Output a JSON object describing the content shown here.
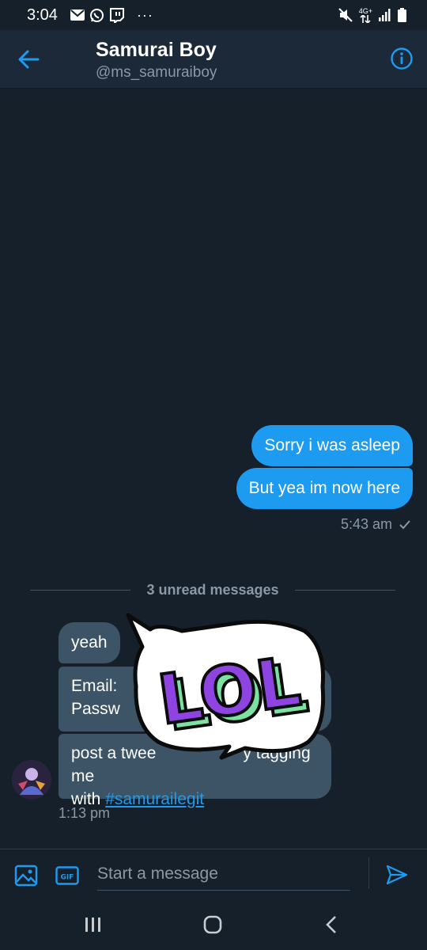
{
  "status_bar": {
    "time": "3:04",
    "more": "···",
    "network": "4G+",
    "icons_left": [
      "mail-icon",
      "whatsapp-icon",
      "twitch-icon"
    ],
    "icons_right": [
      "mute-icon",
      "data-icon",
      "signal-icon",
      "battery-icon"
    ]
  },
  "header": {
    "title": "Samurai Boy",
    "handle": "@ms_samuraiboy"
  },
  "messages_out": [
    {
      "text": "Sorry i was asleep"
    },
    {
      "text": "But yea im now here"
    }
  ],
  "out_time": "5:43 am",
  "unread_divider": "3 unread messages",
  "messages_in": [
    {
      "text": "yeah"
    },
    {
      "line1": "Email:",
      "line2": "Passw"
    },
    {
      "line1": "post a twee",
      "line1_rest": "y tagging me",
      "line2_prefix": "with ",
      "hashtag": "#samurailegit"
    }
  ],
  "in_time": "1:13 pm",
  "sticker": {
    "text": "LOL"
  },
  "composer": {
    "placeholder": "Start a message",
    "gif_label": "GIF"
  },
  "colors": {
    "background": "#15202b",
    "header": "#1c2938",
    "accent": "#1d9bf0",
    "incoming_bubble": "#3d5466",
    "secondary_text": "#8b98a5",
    "sticker_purple": "#8e44e0",
    "sticker_green": "#7be2a4"
  }
}
